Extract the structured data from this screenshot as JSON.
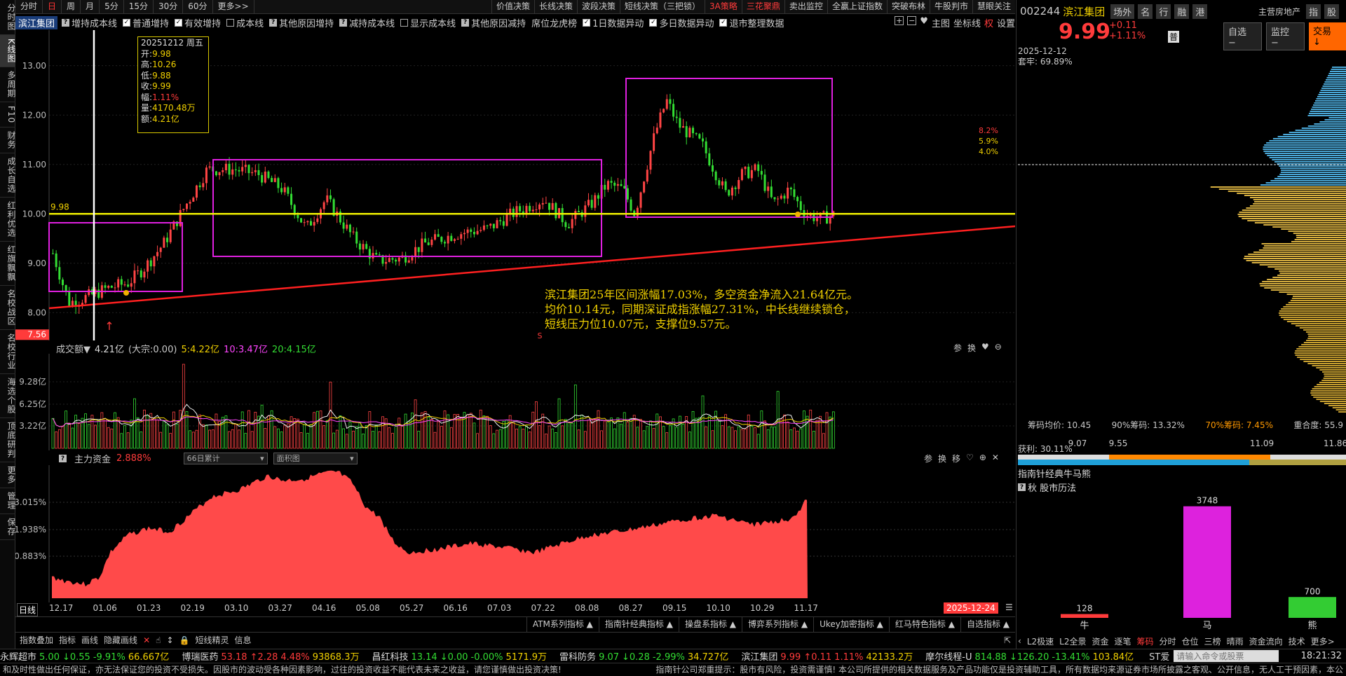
{
  "left_sidebar": [
    "分时图",
    "K线图",
    "多周期",
    "F10",
    "财务",
    "成长自选",
    "红利优选",
    "红旗飘飘",
    "名校战区",
    "名校行业",
    "海选个股",
    "顶底研判",
    "更多",
    "管理",
    "保存"
  ],
  "periods": [
    "分时",
    "日",
    "周",
    "月",
    "5分",
    "15分",
    "30分",
    "60分",
    "更多>>"
  ],
  "period_active": 1,
  "strategies": [
    "价值决策",
    "长线决策",
    "波段决策",
    "短线决策（三把锁）",
    "3A策略",
    "三花聚鼎",
    "卖出监控",
    "全赢上证指数",
    "突破布林",
    "牛股判市",
    "慧眼关注"
  ],
  "options": {
    "stock_tag": "滨江集团",
    "items": [
      {
        "label": "增持成本线",
        "type": "q"
      },
      {
        "label": "普通增持",
        "type": "on"
      },
      {
        "label": "有效增持",
        "type": "on"
      },
      {
        "label": "成本线",
        "type": "off"
      },
      {
        "label": "其他原因增持",
        "type": "q"
      },
      {
        "label": "减持成本线",
        "type": "q"
      },
      {
        "label": "显示成本线",
        "type": "off"
      },
      {
        "label": "其他原因减持",
        "type": "q"
      },
      {
        "label": "席位龙虎榜",
        "type": "none"
      },
      {
        "label": "1日数据异动",
        "type": "on"
      },
      {
        "label": "多日数据异动",
        "type": "on"
      },
      {
        "label": "退市整理数据",
        "type": "on"
      }
    ],
    "tail": [
      "主图",
      "坐标线",
      "权",
      "设置"
    ]
  },
  "k_axis": {
    "ylabels": [
      "13.00",
      "12.00",
      "11.00",
      "10.00",
      "9.00",
      "8.00"
    ],
    "yvals": [
      13,
      12,
      11,
      10,
      9,
      8
    ],
    "ymin": 7.55,
    "ymax": 13.55,
    "low_label": "7.56",
    "ref_label": "9.98",
    "pct_labels": [
      "8.2%",
      "5.9%",
      "4.0%"
    ]
  },
  "infobox": {
    "date": "20251212 周五",
    "rows": [
      {
        "k": "开",
        "v": "9.98"
      },
      {
        "k": "高",
        "v": "10.26"
      },
      {
        "k": "低",
        "v": "9.88"
      },
      {
        "k": "收",
        "v": "9.99"
      },
      {
        "k": "幅",
        "v": "1.11%"
      },
      {
        "k": "量",
        "v": "4170.48万"
      },
      {
        "k": "额",
        "v": "4.21亿"
      }
    ]
  },
  "comment": "滨江集团25年区间涨幅17.03%，多空资金净流入21.64亿元。\n均价10.14元，同期深证成指涨幅27.31%，中长线继续锁仓，\n短线压力位10.07元，支撑位9.57元。",
  "marker_s": "S",
  "volume": {
    "title": "成交额▼",
    "val": "4.21亿",
    "extra": "(大宗:0.00)",
    "ma5": "5:4.22亿",
    "ma10": "10:3.47亿",
    "ma20": "20:4.15亿",
    "ylabels": [
      "9.28亿",
      "6.25亿",
      "3.22亿"
    ],
    "tools": [
      "参",
      "换"
    ]
  },
  "moneyflow": {
    "title": "主力资金",
    "val": "2.888%",
    "dd1": "66日累计",
    "dd2": "面积图",
    "ylabels": [
      "3.015%",
      "1.938%",
      "0.883%"
    ],
    "tools": [
      "参",
      "换",
      "移"
    ]
  },
  "xaxis": {
    "label": "日线",
    "dates": [
      "12.17",
      "01.06",
      "01.23",
      "02.19",
      "03.10",
      "03.27",
      "04.16",
      "05.08",
      "05.27",
      "06.16",
      "07.03",
      "07.22",
      "08.08",
      "08.27",
      "09.15",
      "10.10",
      "10.29",
      "11.17"
    ],
    "end": "2025-12-24"
  },
  "bottom_indicators": [
    "ATM系列指标 ▲",
    "指南针经典指标 ▲",
    "操盘系指标 ▲",
    "博弈系列指标 ▲",
    "Ukey加密指标 ▲",
    "红马特色指标 ▲",
    "自选指标 ▲"
  ],
  "bottom_tools": [
    "指数叠加",
    "指标",
    "画线",
    "隐藏画线",
    "短线精灵",
    "信息"
  ],
  "ticker": [
    {
      "n": "永辉超市",
      "p": "5.00",
      "c": "↓0.55",
      "pc": "-9.91%",
      "a": "66.667亿",
      "dir": "g"
    },
    {
      "n": "博瑞医药",
      "p": "53.18",
      "c": "↑2.28",
      "pc": "4.48%",
      "a": "93868.3万",
      "dir": "r"
    },
    {
      "n": "昌红科技",
      "p": "13.14",
      "c": "↓0.00",
      "pc": "-0.00%",
      "a": "5171.9万",
      "dir": "g"
    },
    {
      "n": "雷科防务",
      "p": "9.07",
      "c": "↓0.28",
      "pc": "-2.99%",
      "a": "34.727亿",
      "dir": "g"
    },
    {
      "n": "滨江集团",
      "p": "9.99",
      "c": "↑0.11",
      "pc": "1.11%",
      "a": "42133.2万",
      "dir": "r"
    },
    {
      "n": "摩尔线程-U",
      "p": "814.88",
      "c": "↓126.20",
      "pc": "-13.41%",
      "a": "103.84亿",
      "dir": "g"
    }
  ],
  "ticker_tail": {
    "st": "ST爱",
    "input_placeholder": "请输入命令或股票",
    "time": "18:21:32"
  },
  "disclaimer_left": "和及时性做出任何保证，亦无法保证您的投资不受损失。因股市的波动受各种因素影响，过往的投资收益不能代表未来之收益，请您谨慎做出投资决策!",
  "disclaimer_right": "指南针公司郑重提示：股市有风险，投资需谨慎! 本公司所提供的相关数据服务及产品功能仅是投资辅助工具，所有数据均来源证券市场所披露之客观、公开信息，无人工干预因素，本公",
  "right": {
    "code": "002244",
    "name": "滨江集团",
    "tabs": [
      "场外",
      "名",
      "行",
      "融",
      "港"
    ],
    "industry": "主营房地产",
    "side_tabs": [
      "指",
      "股"
    ],
    "price": "9.99",
    "chg": "+0.11",
    "pct": "+1.11%",
    "badge": "普",
    "btns": [
      "自选 −",
      "监控 −",
      "交易 ↓"
    ],
    "date": "2025-12-12",
    "lock": "套牢: 69.89%",
    "profit": "获利: 30.11%",
    "stats": {
      "avg": "筹码均价: 10.45",
      "c90": "90%筹码: 13.32%",
      "c70": "70%筹码: 7.45%",
      "overlap": "重合度: 55.9"
    },
    "bar_labels": [
      "9.07",
      "9.55",
      "11.09",
      "11.86"
    ],
    "zn_title": "指南针经典牛马熊",
    "zn_sub": "秋  股市历法",
    "bears": {
      "labels": [
        "牛",
        "马",
        "熊"
      ],
      "values": [
        128,
        3748,
        700
      ],
      "colors": [
        "#ff3b3b",
        "#dd22dd",
        "#33cc33"
      ]
    },
    "bottom_tabs": [
      "L2极速",
      "L2全景",
      "资金",
      "逐笔",
      "筹码",
      "分时",
      "仓位",
      "三榜",
      "晴雨",
      "资金流向",
      "技术",
      "更多>"
    ]
  }
}
